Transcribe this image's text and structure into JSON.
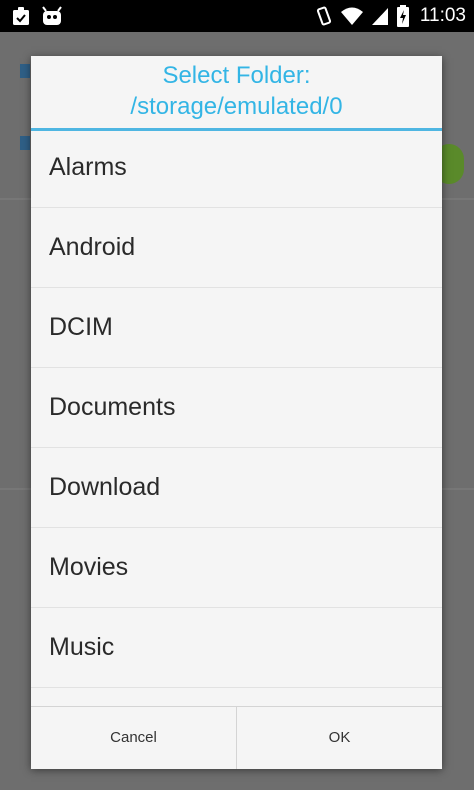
{
  "status_bar": {
    "time": "11:03",
    "icons": [
      "clipboard-check-icon",
      "android-icon",
      "vibrate-icon",
      "wifi-icon",
      "signal-icon",
      "battery-charging-icon"
    ]
  },
  "dialog": {
    "title_line1": "Select Folder:",
    "title_line2": "/storage/emulated/0",
    "folders": [
      {
        "label": "Alarms"
      },
      {
        "label": "Android"
      },
      {
        "label": "DCIM"
      },
      {
        "label": "Documents"
      },
      {
        "label": "Download"
      },
      {
        "label": "Movies"
      },
      {
        "label": "Music"
      },
      {
        "label": ""
      }
    ],
    "cancel_label": "Cancel",
    "ok_label": "OK"
  },
  "colors": {
    "title": "#33b5e5",
    "divider": "#4fb6e2",
    "dialog_bg": "#f5f5f5",
    "scrim": "#6e6e6e"
  }
}
